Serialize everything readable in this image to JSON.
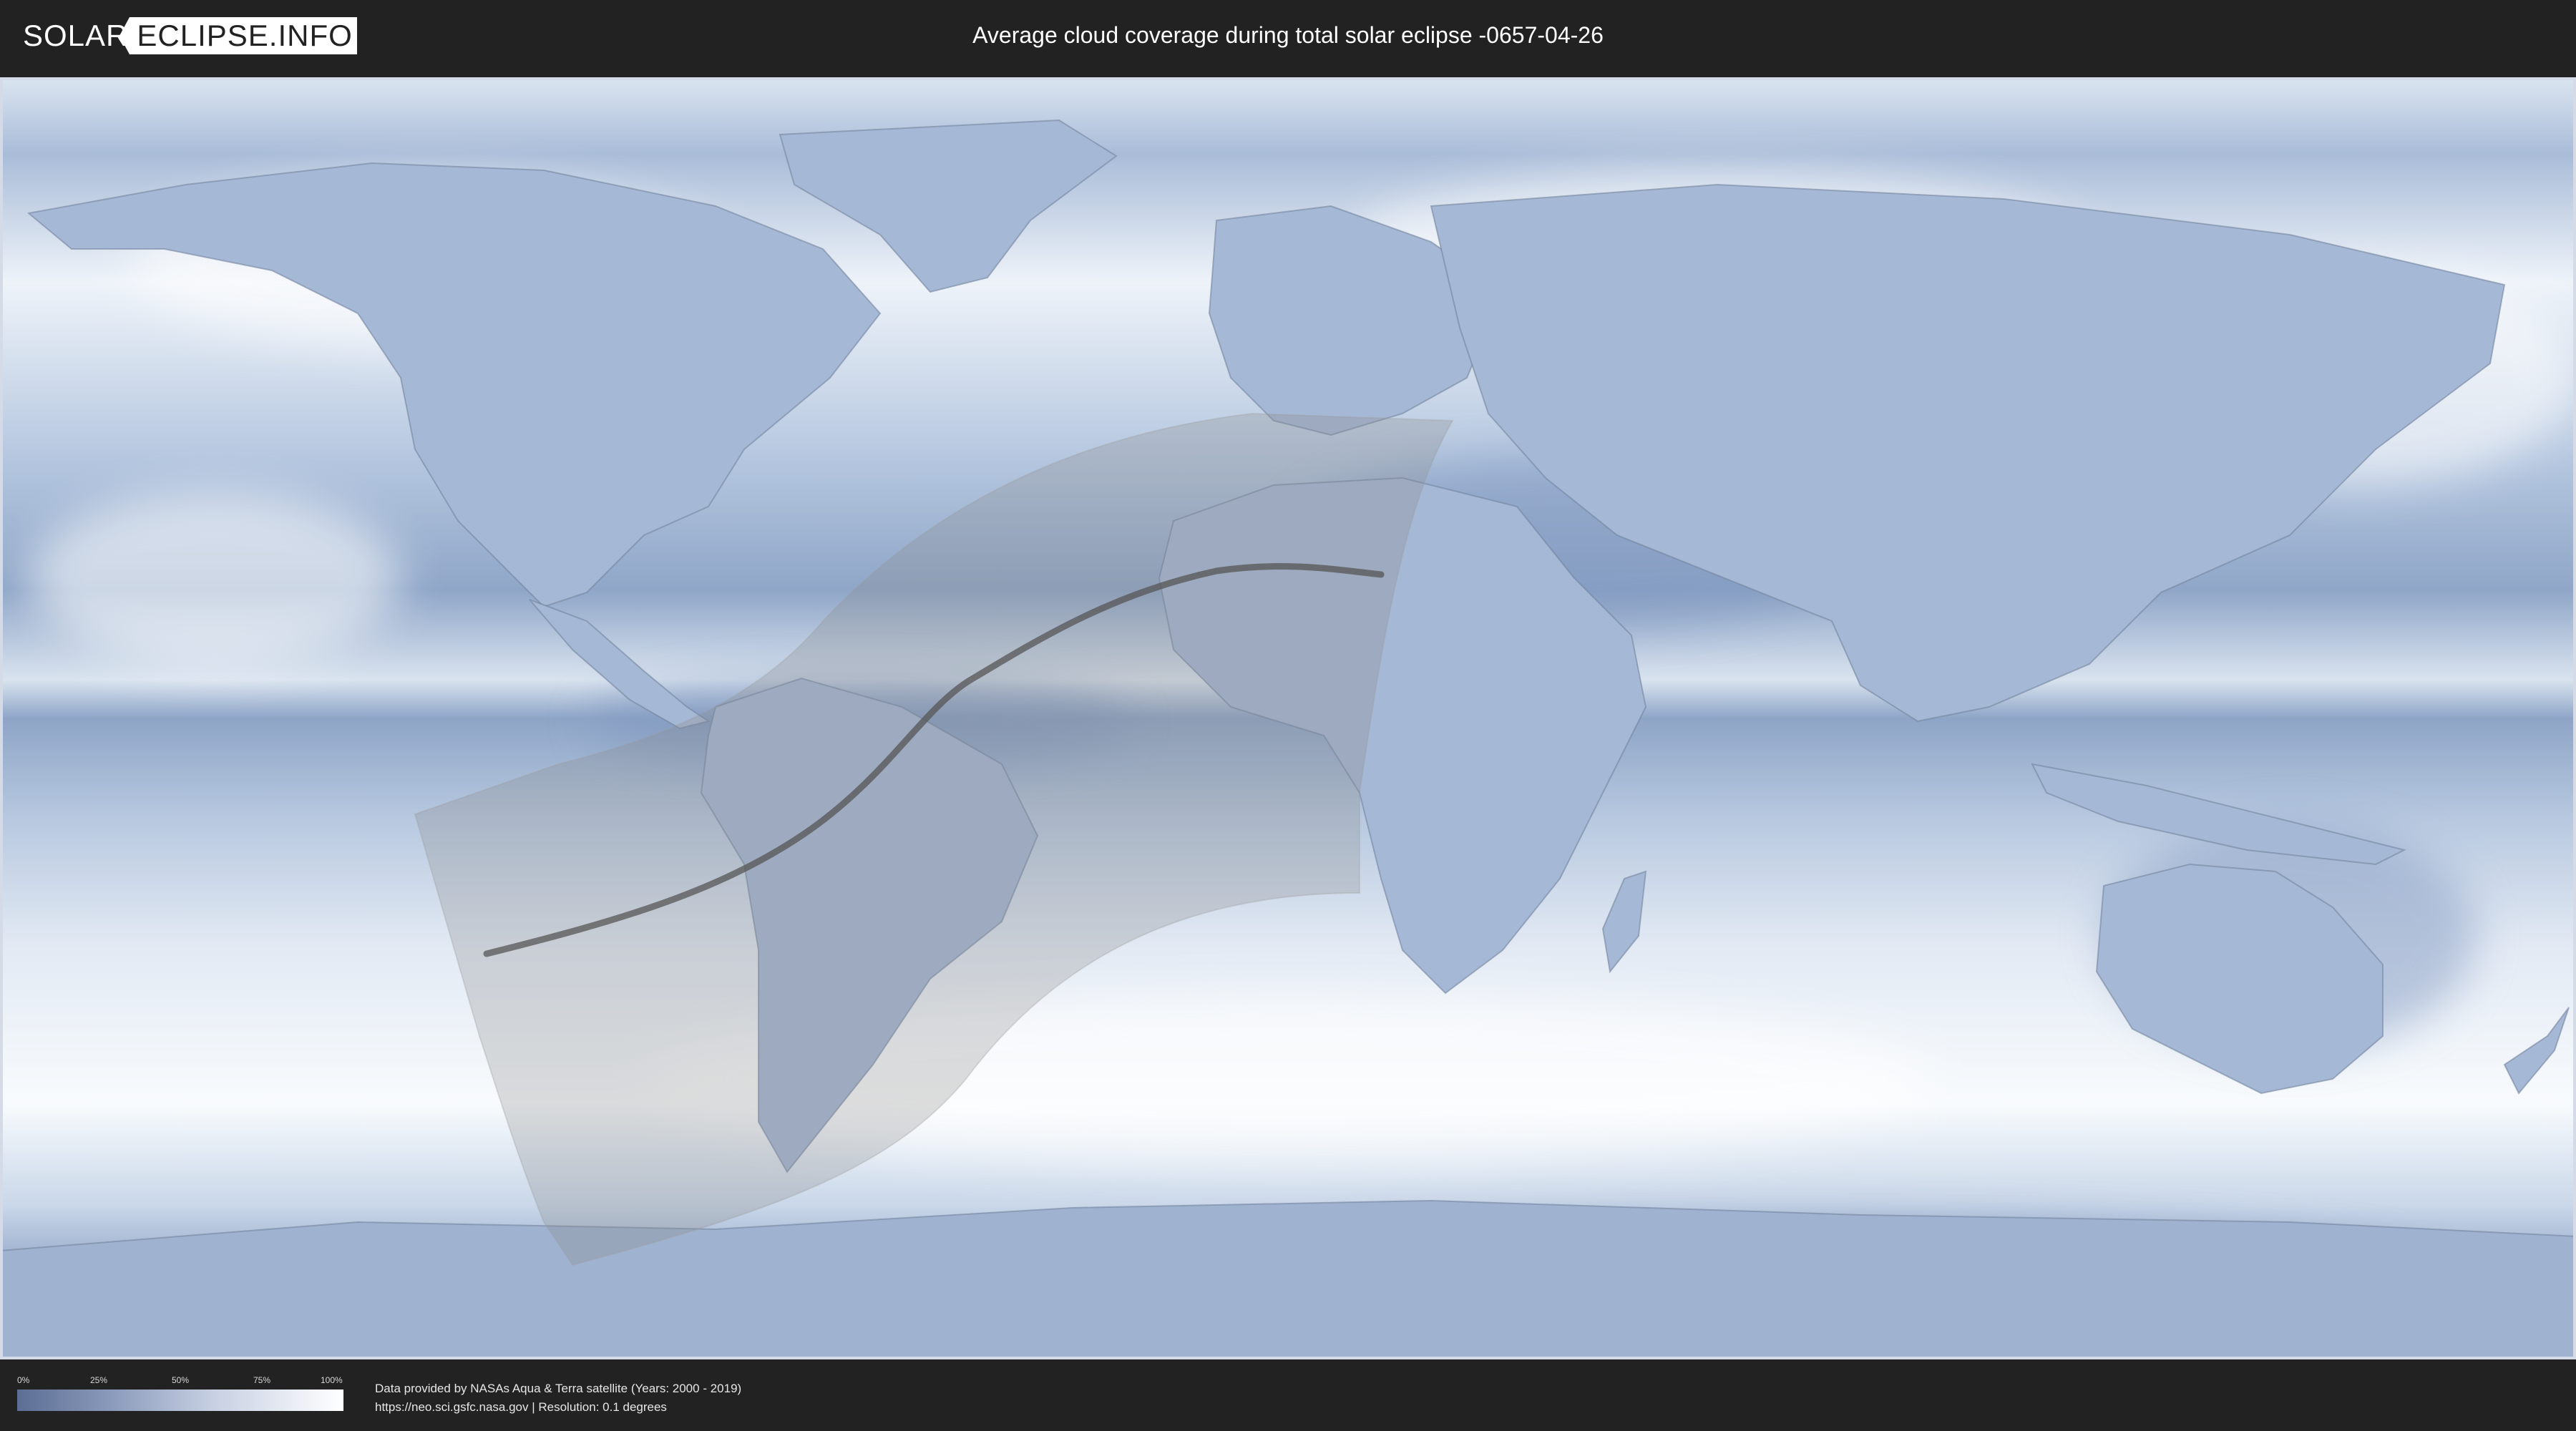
{
  "header": {
    "logo_part1": "SOLAR",
    "logo_part2": "ECLIPSE.INFO",
    "title": "Average cloud coverage during total solar eclipse -0657-04-26"
  },
  "legend": {
    "labels": [
      "0%",
      "25%",
      "50%",
      "75%",
      "100%"
    ],
    "colors": [
      "#5c6e95",
      "#8c9cbc",
      "#c7d0e2",
      "#ffffff"
    ]
  },
  "footer": {
    "credit_line1": "Data provided by NASAs Aqua & Terra satellite (Years: 2000 - 2019)",
    "credit_line2": "https://neo.sci.gsfc.nasa.gov | Resolution: 0.1 degrees"
  },
  "map": {
    "cloud_low_color": "#5c6e95",
    "cloud_high_color": "#ffffff",
    "eclipse_zone_color": "#888888",
    "central_line_color": "#555555"
  }
}
